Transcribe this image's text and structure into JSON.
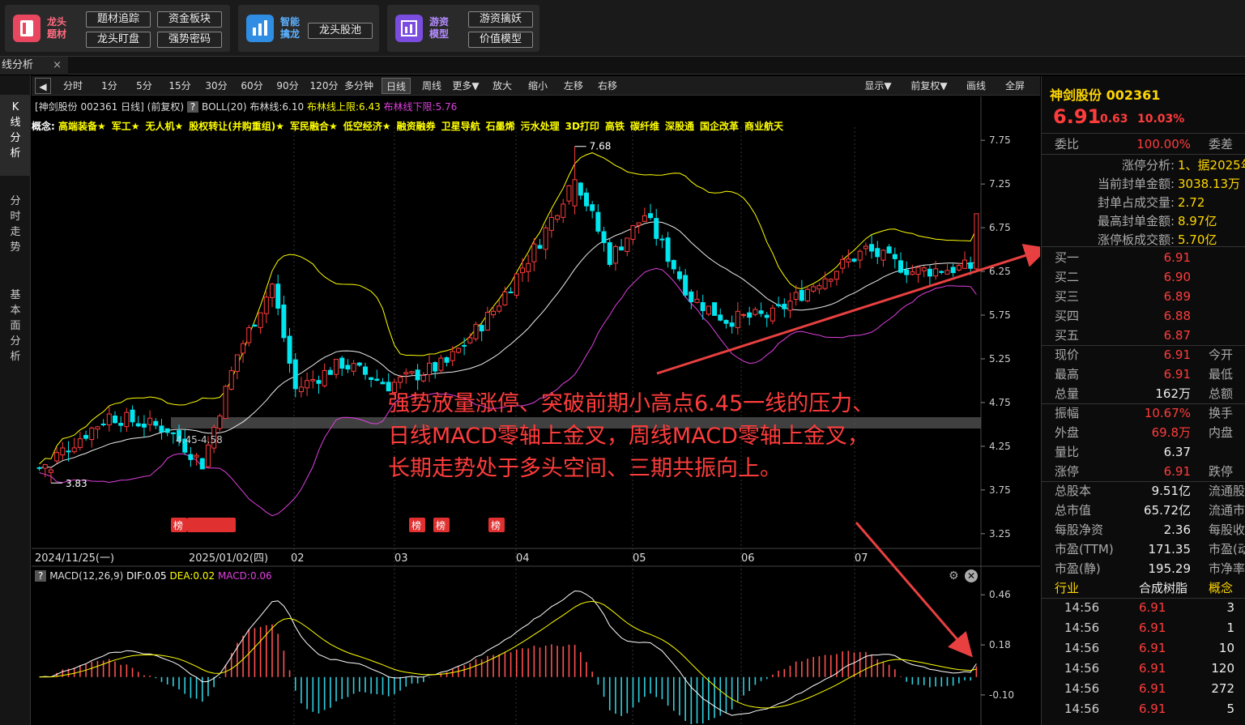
{
  "toolbar": {
    "groups": [
      {
        "label1": "龙头",
        "label2": "题材",
        "color": "#e8475f",
        "buttons": [
          "题材追踪",
          "资金板块",
          "龙头盯盘",
          "强势密码"
        ]
      },
      {
        "label1": "智能",
        "label2": "擒龙",
        "color": "#2f8de4",
        "buttons": [
          "龙头股池"
        ]
      },
      {
        "label1": "游资",
        "label2": "模型",
        "color": "#7a4de0",
        "buttons": [
          "游资擒妖",
          "价值模型"
        ]
      }
    ]
  },
  "tab": {
    "label": "线分析",
    "close": "×"
  },
  "side_nav": [
    {
      "label": "K\n线\n分\n析"
    },
    {
      "label": "分\n时\n走\n势"
    },
    {
      "label": "基\n本\n面\n分\n析"
    }
  ],
  "period_bar": {
    "back": "◀",
    "items": [
      "分时",
      "1分",
      "5分",
      "15分",
      "30分",
      "60分",
      "90分",
      "120分",
      "多分钟",
      "日线",
      "周线",
      "更多▼",
      "放大",
      "缩小",
      "左移",
      "右移"
    ],
    "active": "日线",
    "right_items": [
      "显示▼",
      "前复权▼",
      "画线",
      "全屏"
    ]
  },
  "info": {
    "stock": "[神剑股份 002361 日线]",
    "adjust": "(前复权)",
    "help": "?",
    "boll": "BOLL(20)",
    "mid": "布林线:6.10",
    "upper": "布林线上限:6.43",
    "lower": "布林线下限:5.76"
  },
  "concepts": {
    "prefix": "概念:",
    "items": [
      "高端装备★",
      "军工★",
      "无人机★",
      "股权转让(并购重组)★",
      "军民融合★",
      "低空经济★",
      "融资融券",
      "卫星导航",
      "石墨烯",
      "污水处理",
      "3D打印",
      "高铁",
      "碳纤维",
      "深股通",
      "国企改革",
      "商业航天"
    ]
  },
  "macd_info": {
    "help": "?",
    "label": "MACD(12,26,9)",
    "dif": "DIF:0.05",
    "dea": "DEA:0.02",
    "macd": "MACD:0.06"
  },
  "annotation": {
    "line1": "强势放量涨停、突破前期小高点6.45一线的压力、",
    "line2": "日线MACD零轴上金叉，周线MACD零轴上金叉，",
    "line3": "长期走势处于多头空间、三期共振向上。"
  },
  "chart_data": {
    "type": "candlestick",
    "price_axis": {
      "ylim": [
        3.1,
        7.9
      ],
      "ticks": [
        "7.75",
        "7.25",
        "6.75",
        "6.25",
        "5.75",
        "5.25",
        "4.75",
        "4.25",
        "3.75",
        "3.25"
      ]
    },
    "x_labels": [
      "2024/11/25(一)",
      "2025/01/02(四)",
      "02",
      "03",
      "04",
      "05",
      "06",
      "07"
    ],
    "high_label": "7.68",
    "low_label": "3.83",
    "range_label": "4.45-4.58",
    "bang_labels": [
      "榜",
      "榜",
      "榜",
      "榜"
    ],
    "macd_axis": {
      "ylim": [
        -0.25,
        0.52
      ],
      "ticks": [
        "0.46",
        "0.18",
        "-0.10"
      ]
    }
  },
  "right_panel": {
    "name": "神剑股份 002361",
    "price": "6.91",
    "change": "0.63",
    "pct": "10.03%",
    "weibi_label": "委比",
    "weibi": "100.00%",
    "weicha_label": "委差",
    "limit_info": [
      {
        "label": "涨停分析:",
        "value": "1、据2025年"
      },
      {
        "label": "当前封单金额:",
        "value": "3038.13万"
      },
      {
        "label": "封单占成交量:",
        "value": "2.72"
      },
      {
        "label": "最高封单金额:",
        "value": "8.97亿"
      },
      {
        "label": "涨停板成交额:",
        "value": "5.70亿"
      }
    ],
    "bids": [
      {
        "label": "买一",
        "value": "6.91"
      },
      {
        "label": "买二",
        "value": "6.90"
      },
      {
        "label": "买三",
        "value": "6.89"
      },
      {
        "label": "买四",
        "value": "6.88"
      },
      {
        "label": "买五",
        "value": "6.87"
      }
    ],
    "quote": [
      {
        "label": "现价",
        "value": "6.91",
        "red": true,
        "right": "今开"
      },
      {
        "label": "最高",
        "value": "6.91",
        "red": true,
        "right": "最低"
      },
      {
        "label": "总量",
        "value": "162万",
        "red": false,
        "right": "总额"
      },
      {
        "label": "振幅",
        "value": "10.67%",
        "red": true,
        "right": "换手"
      },
      {
        "label": "外盘",
        "value": "69.8万",
        "red": true,
        "right": "内盘"
      },
      {
        "label": "量比",
        "value": "6.37",
        "red": false,
        "right": ""
      },
      {
        "label": "涨停",
        "value": "6.91",
        "red": true,
        "right": "跌停"
      },
      {
        "label": "总股本",
        "value": "9.51亿",
        "red": false,
        "right": "流通股"
      },
      {
        "label": "总市值",
        "value": "65.72亿",
        "red": false,
        "right": "流通市"
      },
      {
        "label": "每股净资",
        "value": "2.36",
        "red": false,
        "right": "每股收"
      },
      {
        "label": "市盈(TTM)",
        "value": "171.35",
        "red": false,
        "right": "市盈(动"
      },
      {
        "label": "市盈(静)",
        "value": "195.29",
        "red": false,
        "right": "市净率"
      }
    ],
    "industry": {
      "label": "行业",
      "value": "合成树脂",
      "concept": "概念"
    },
    "ticks": [
      {
        "time": "14:56",
        "price": "6.91",
        "vol": "3"
      },
      {
        "time": "14:56",
        "price": "6.91",
        "vol": "1"
      },
      {
        "time": "14:56",
        "price": "6.91",
        "vol": "10"
      },
      {
        "time": "14:56",
        "price": "6.91",
        "vol": "120"
      },
      {
        "time": "14:56",
        "price": "6.91",
        "vol": "272"
      },
      {
        "time": "14:56",
        "price": "6.91",
        "vol": "5"
      }
    ]
  }
}
